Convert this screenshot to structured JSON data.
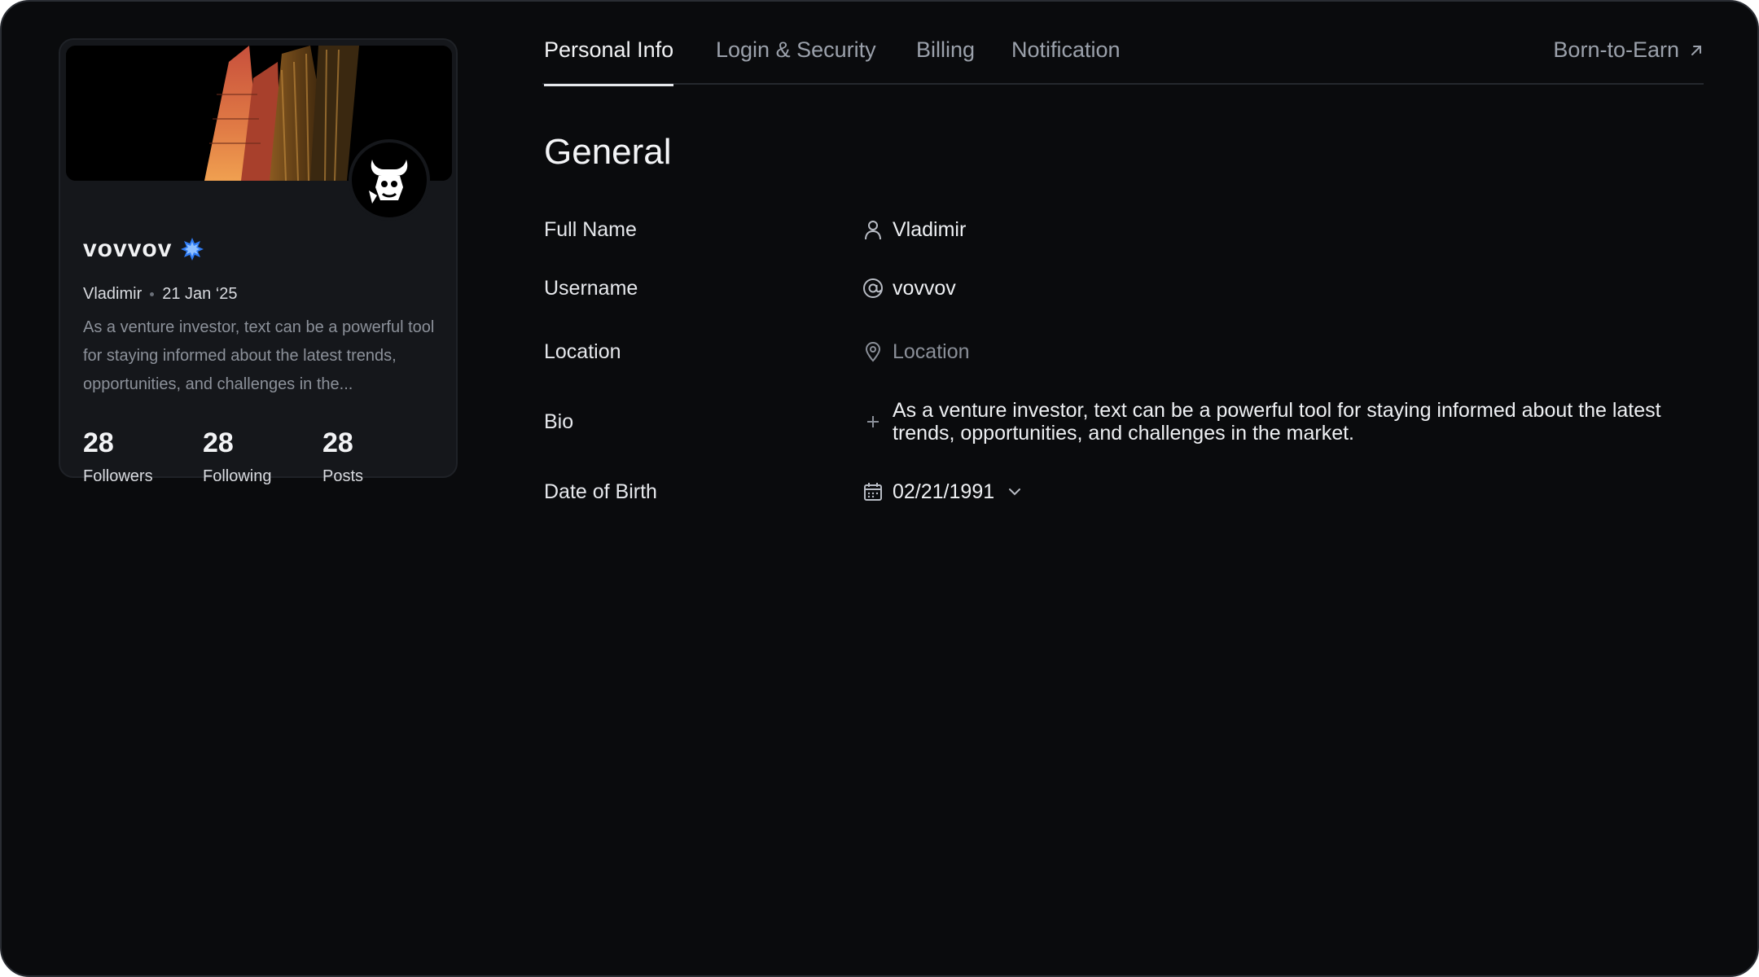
{
  "profile": {
    "username": "vovvov",
    "name": "Vladimir",
    "joined": "21 Jan ‘25",
    "bio": "As a venture investor, text can be a powerful tool for staying informed about the latest trends, opportunities, and challenges in the...",
    "stats": [
      {
        "value": "28",
        "label": "Followers"
      },
      {
        "value": "28",
        "label": "Following"
      },
      {
        "value": "28",
        "label": "Posts"
      }
    ]
  },
  "tabs": [
    {
      "label": "Personal Info",
      "active": true
    },
    {
      "label": "Login & Security",
      "active": false
    },
    {
      "label": "Billing",
      "active": false
    },
    {
      "label": "Notification",
      "active": false
    }
  ],
  "external_link": {
    "label": "Born-to-Earn",
    "icon": "arrow-up-right-icon"
  },
  "section": {
    "title": "General"
  },
  "fields": {
    "full_name": {
      "label": "Full Name",
      "value": "Vladimir",
      "icon": "user-icon"
    },
    "username": {
      "label": "Username",
      "value": "vovvov",
      "icon": "at-icon"
    },
    "location": {
      "label": "Location",
      "placeholder": "Location",
      "icon": "map-pin-icon"
    },
    "bio": {
      "label": "Bio",
      "value": "As a venture investor, text can be a powerful tool for staying informed about the latest trends, opportunities, and challenges in the market.",
      "icon": "plus-icon"
    },
    "dob": {
      "label": "Date of Birth",
      "value": "02/21/1991",
      "icon": "calendar-icon"
    }
  },
  "colors": {
    "background": "#0a0b0d",
    "card": "#15171b",
    "verified": "#2f7cf6"
  }
}
